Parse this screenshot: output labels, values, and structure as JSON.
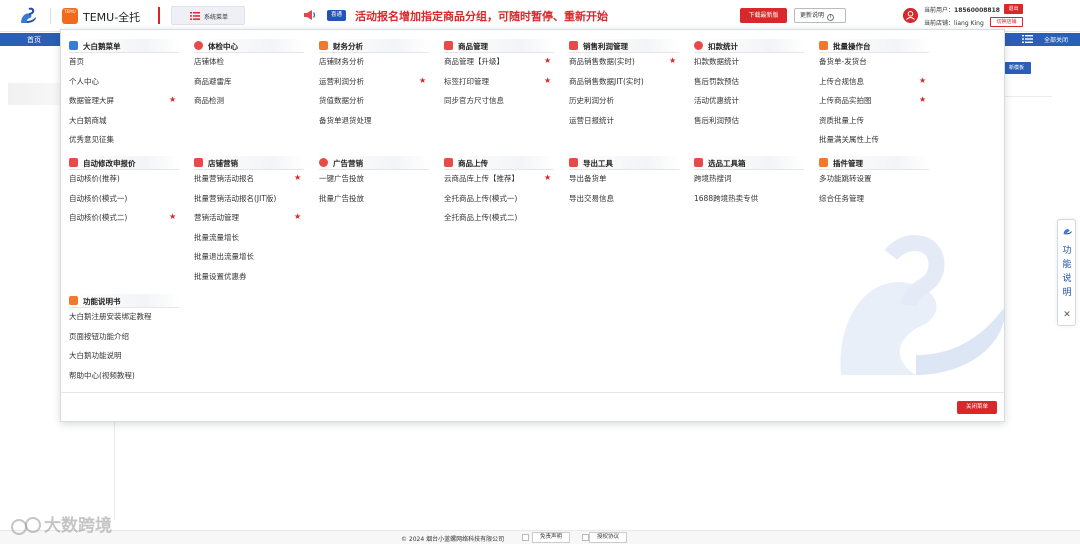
{
  "header": {
    "brand_badge": "TEMU",
    "app_title": "TEMU-全托",
    "system_menu_label": "系统菜单",
    "notice_tag": "喜通",
    "notice_text": "活动报名增加指定商品分组，可随时暂停、重新开始",
    "download_label": "下载最新版",
    "update_label": "更新说明",
    "update_icon": "i",
    "user_label": "当前用户：",
    "user_value": "18560008818",
    "shop_label": "当前店铺：",
    "shop_value": "liang King",
    "logout_label": "退出",
    "switch_shop_label": "切换店铺"
  },
  "nav": {
    "home": "首页",
    "close_all": "全部关闭"
  },
  "background": {
    "template_button": "新模板"
  },
  "side_float": {
    "label": "功能说明",
    "close": "✕"
  },
  "menu": {
    "columns": [
      {
        "title": "大白鹅菜单",
        "items": [
          {
            "label": "首页",
            "star": false
          },
          {
            "label": "个人中心",
            "star": false
          },
          {
            "label": "数据管理大屏",
            "star": true
          },
          {
            "label": "大白鹅商城",
            "star": false
          },
          {
            "label": "优秀意见征集",
            "star": false
          }
        ]
      },
      {
        "title": "体检中心",
        "items": [
          {
            "label": "店铺体检",
            "star": false
          },
          {
            "label": "商品避雷库",
            "star": false
          },
          {
            "label": "商品检测",
            "star": false
          }
        ]
      },
      {
        "title": "财务分析",
        "items": [
          {
            "label": "店铺财务分析",
            "star": false
          },
          {
            "label": "运营利润分析",
            "star": true
          },
          {
            "label": "货值数据分析",
            "star": false
          },
          {
            "label": "备货单退货处理",
            "star": false
          }
        ]
      },
      {
        "title": "商品管理",
        "items": [
          {
            "label": "商品管理【升级】",
            "star": true
          },
          {
            "label": "标签打印管理",
            "star": true
          },
          {
            "label": "同步官方尺寸信息",
            "star": false
          }
        ]
      },
      {
        "title": "销售利润管理",
        "items": [
          {
            "label": "商品销售数据(实时)",
            "star": true
          },
          {
            "label": "商品销售数据JIT(实时)",
            "star": false
          },
          {
            "label": "历史利润分析",
            "star": false
          },
          {
            "label": "运营日报统计",
            "star": false
          }
        ]
      },
      {
        "title": "扣款统计",
        "items": [
          {
            "label": "扣款数据统计",
            "star": false
          },
          {
            "label": "售后罚款预估",
            "star": false
          },
          {
            "label": "活动优惠统计",
            "star": false
          },
          {
            "label": "售后利润预估",
            "star": false
          }
        ]
      },
      {
        "title": "批量操作台",
        "items": [
          {
            "label": "备货单-发货台",
            "star": false
          },
          {
            "label": "上传合规信息",
            "star": true
          },
          {
            "label": "上传商品实拍图",
            "star": true
          },
          {
            "label": "资质批量上传",
            "star": false
          },
          {
            "label": "批量满关属性上传",
            "star": false
          }
        ]
      },
      {
        "title": "自动修改申报价",
        "items": [
          {
            "label": "自动核价(推荐)",
            "star": false
          },
          {
            "label": "自动核价(模式一)",
            "star": false
          },
          {
            "label": "自动核价(模式二)",
            "star": true
          }
        ]
      },
      {
        "title": "店铺营销",
        "items": [
          {
            "label": "批量营销活动报名",
            "star": true
          },
          {
            "label": "批量营销活动报名(JIT版)",
            "star": false
          },
          {
            "label": "营销活动管理",
            "star": true
          },
          {
            "label": "批量流量增长",
            "star": false
          },
          {
            "label": "批量退出流量增长",
            "star": false
          },
          {
            "label": "批量设置优惠券",
            "star": false
          }
        ]
      },
      {
        "title": "广告营销",
        "items": [
          {
            "label": "一键广告投放",
            "star": false
          },
          {
            "label": "批量广告投放",
            "star": false
          }
        ]
      },
      {
        "title": "商品上传",
        "items": [
          {
            "label": "云商品库上传【推荐】",
            "star": true
          },
          {
            "label": "全托商品上传(模式一)",
            "star": false
          },
          {
            "label": "全托商品上传(模式二)",
            "star": false
          }
        ]
      },
      {
        "title": "导出工具",
        "items": [
          {
            "label": "导出备货单",
            "star": false
          },
          {
            "label": "导出交易信息",
            "star": false
          }
        ]
      },
      {
        "title": "选品工具箱",
        "items": [
          {
            "label": "跨境热搜词",
            "star": false
          },
          {
            "label": "1688跨境热卖专供",
            "star": false
          }
        ]
      },
      {
        "title": "插件管理",
        "items": [
          {
            "label": "多功能跳转设置",
            "star": false
          },
          {
            "label": "综合任务管理",
            "star": false
          }
        ]
      },
      {
        "title": "功能说明书",
        "items": [
          {
            "label": "大白鹅注册安装绑定教程",
            "star": false
          },
          {
            "label": "页面按钮功能介绍",
            "star": false
          },
          {
            "label": "大白鹅功能说明",
            "star": false
          },
          {
            "label": "帮助中心(视频教程)",
            "star": false
          }
        ]
      }
    ],
    "star_glyph": "★",
    "close_menu_label": "关闭菜单"
  },
  "footer": {
    "copyright": "© 2024 烟台小蓝螺网络科技有限公司",
    "disclaimer": "免责声明",
    "license": "授权协议"
  },
  "page_watermark": "大数跨境",
  "colors": {
    "brand_blue": "#2b5fb6",
    "accent_red": "#d8282b",
    "temu_orange": "#f26a1b"
  },
  "icons": {
    "logo": "swan-logo-icon",
    "menu": "list-icon",
    "notice": "speaker-icon",
    "col_1": "swan-icon",
    "col_2": "diamond-icon",
    "col_3": "wallet-icon",
    "col_4": "box-icon",
    "col_5": "chart-icon",
    "col_6": "tag-icon",
    "col_7": "grid-icon",
    "col_8": "price-icon",
    "col_9": "shop-icon",
    "col_10": "diamond-icon",
    "col_11": "upload-icon",
    "col_12": "export-icon",
    "col_13": "toolbox-icon",
    "col_14": "plugin-icon",
    "col_15": "book-icon"
  }
}
